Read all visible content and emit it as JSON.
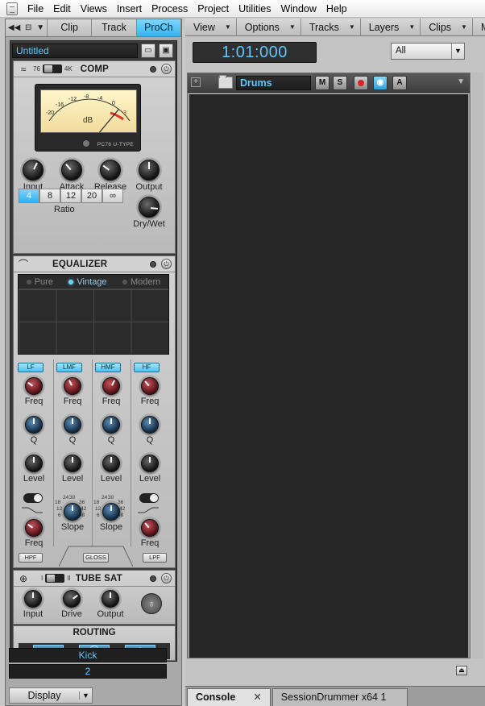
{
  "menu": [
    "File",
    "Edit",
    "Views",
    "Insert",
    "Process",
    "Project",
    "Utilities",
    "Window",
    "Help"
  ],
  "left_tabs": {
    "clip": "Clip",
    "track": "Track",
    "prochannel": "ProCh"
  },
  "preset": {
    "name": "Untitled"
  },
  "comp": {
    "title": "COMP",
    "mode_left": "76",
    "mode_right": "4K",
    "vu": {
      "scale": [
        "-20",
        "-16",
        "-12",
        "-8",
        "-4",
        "0",
        "3"
      ],
      "unit": "dB",
      "brand": "PC76 U-TYPE"
    },
    "knobs": [
      {
        "label": "Input",
        "value": 0.6
      },
      {
        "label": "Attack",
        "value": 0.35
      },
      {
        "label": "Release",
        "value": 0.3
      },
      {
        "label": "Output",
        "value": 0.5
      }
    ],
    "ratio": {
      "options": [
        "4",
        "8",
        "12",
        "20",
        "∞"
      ],
      "selected": "4",
      "label": "Ratio"
    },
    "drywet": {
      "label": "Dry/Wet",
      "value": 0.85
    }
  },
  "eq": {
    "title": "EQUALIZER",
    "modes": [
      {
        "label": "Pure",
        "active": false
      },
      {
        "label": "Vintage",
        "active": true
      },
      {
        "label": "Modern",
        "active": false
      }
    ],
    "bands": [
      {
        "name": "LF",
        "freq": 0.3,
        "q": 0.5,
        "level": 0.5
      },
      {
        "name": "LMF",
        "freq": 0.4,
        "q": 0.5,
        "level": 0.5
      },
      {
        "name": "HMF",
        "freq": 0.6,
        "q": 0.5,
        "level": 0.5
      },
      {
        "name": "HF",
        "freq": 0.35,
        "q": 0.5,
        "level": 0.5
      }
    ],
    "labels": {
      "freq": "Freq",
      "q": "Q",
      "level": "Level",
      "slope": "Slope"
    },
    "slope_scale": {
      "left": [
        "18",
        "12",
        "6"
      ],
      "top": [
        "24",
        "30"
      ],
      "right": [
        "36",
        "42",
        "48"
      ]
    },
    "buttons": {
      "hpf": "HPF",
      "gloss": "GLOSS",
      "lpf": "LPF"
    }
  },
  "tubesat": {
    "title": "TUBE SAT",
    "mode_left": "I",
    "mode_right": "II",
    "knobs": [
      {
        "label": "Input",
        "value": 0.5
      },
      {
        "label": "Drive",
        "value": 0.7
      },
      {
        "label": "Output",
        "value": 0.5
      }
    ]
  },
  "routing": {
    "title": "ROUTING"
  },
  "channel": {
    "name": "Kick",
    "number": "2"
  },
  "display": {
    "label": "Display"
  },
  "toolbar": [
    "View",
    "Options",
    "Tracks",
    "Layers",
    "Clips",
    "MI"
  ],
  "time": "1:01:000",
  "filter": {
    "value": "All"
  },
  "track": {
    "name": "Drums",
    "buttons": [
      "M",
      "S",
      "A"
    ]
  },
  "bottom_tabs": {
    "console": "Console",
    "close": "✕",
    "drummer": "SessionDrummer x64 1"
  },
  "colors": {
    "accent": "#5ec8ff",
    "panel": "#3a3a3a"
  }
}
